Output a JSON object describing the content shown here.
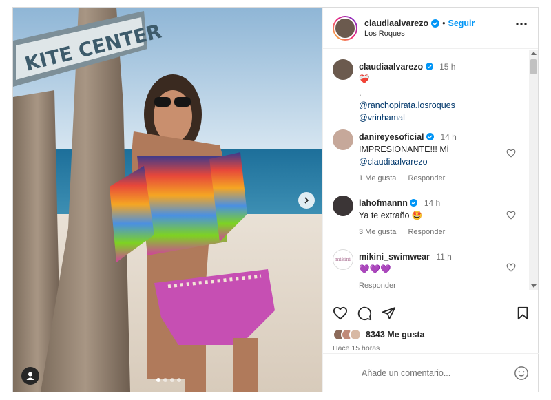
{
  "post": {
    "author": {
      "username": "claudiaalvarezo",
      "verified": true,
      "follow_label": "Seguir",
      "separator": "•",
      "location": "Los Roques"
    },
    "photo": {
      "sign_text": "KITE CENTER",
      "slide_count": 4,
      "active_slide": 1
    },
    "caption": {
      "username": "claudiaalvarezo",
      "time": "15 h",
      "emoji": "❤️‍🩹",
      "line_dot": ".",
      "mention_1": "@ranchopirata.losroques",
      "mention_2": "@vrinhamal"
    },
    "comments": [
      {
        "username": "danireyesoficial",
        "verified": true,
        "time": "14 h",
        "text": "IMPRESIONANTE!!! Mi",
        "mention": "@claudiaalvarezo",
        "likes": "1 Me gusta",
        "reply": "Responder"
      },
      {
        "username": "lahofmannn",
        "verified": true,
        "time": "14 h",
        "text": "Ya te extraño 🤩",
        "likes": "3 Me gusta",
        "reply": "Responder"
      },
      {
        "username": "mikini_swimwear",
        "verified": false,
        "time": "11 h",
        "avatar_text": "mikini",
        "text": "💜💜💜",
        "reply": "Responder"
      }
    ],
    "likes": {
      "count_label": "8343 Me gusta"
    },
    "posted": "Hace 15 horas",
    "comment_input": {
      "placeholder": "Añade un comentario..."
    }
  },
  "icons": [
    "more-icon",
    "heart-icon",
    "comment-icon",
    "share-icon",
    "save-icon",
    "emoji-icon",
    "chevron-right-icon",
    "user-tag-icon",
    "verified-icon"
  ],
  "colors": {
    "accent": "#0095f6",
    "verified": "#0095f6",
    "text_secondary": "#737373",
    "border": "#dbdbdb",
    "mention": "#00376b"
  }
}
